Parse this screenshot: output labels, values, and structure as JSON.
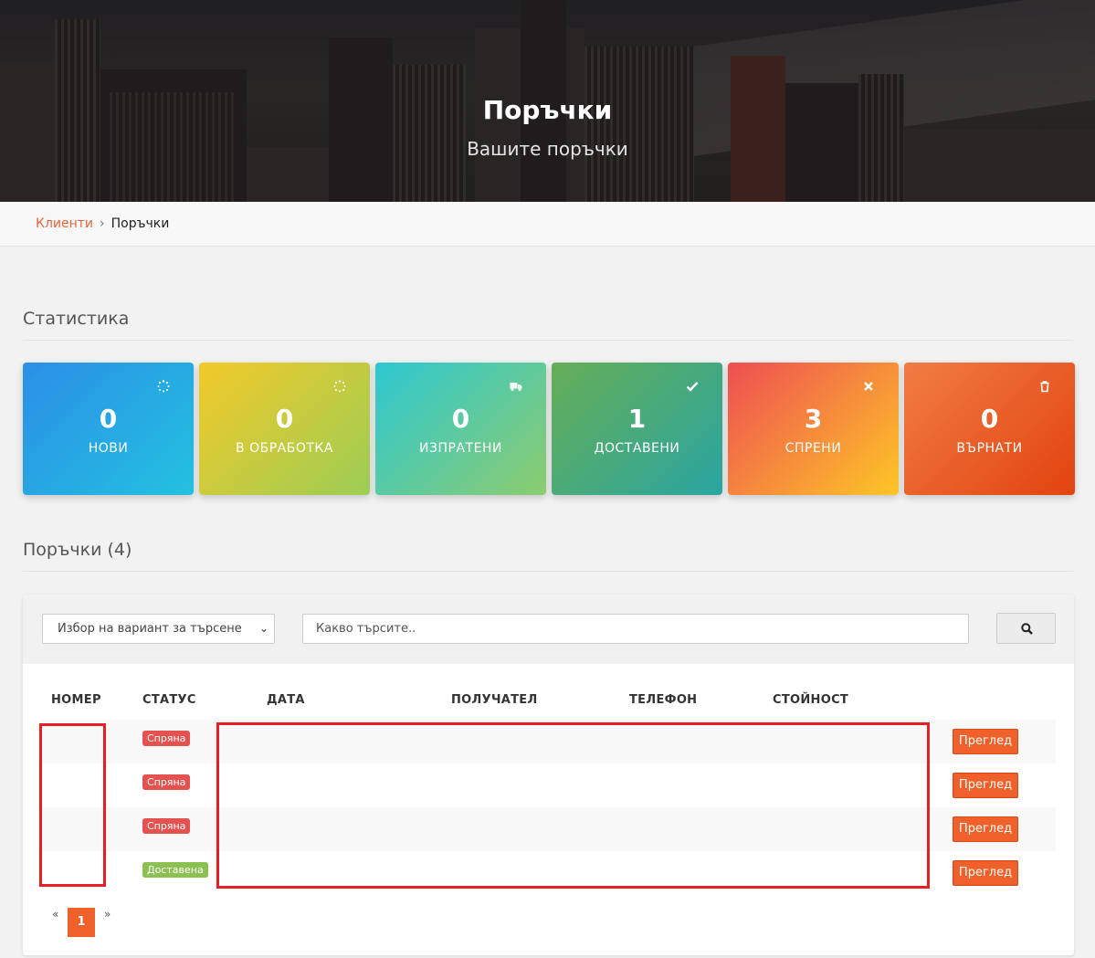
{
  "header": {
    "title": "Поръчки",
    "subtitle": "Вашите поръчки"
  },
  "breadcrumb": {
    "parent": "Клиенти",
    "current": "Поръчки"
  },
  "statistics": {
    "title": "Статистика",
    "cards": [
      {
        "value": "0",
        "label": "НОВИ",
        "icon": "spinner-icon"
      },
      {
        "value": "0",
        "label": "В ОБРАБОТКА",
        "icon": "spinner-icon"
      },
      {
        "value": "0",
        "label": "ИЗПРАТЕНИ",
        "icon": "truck-icon"
      },
      {
        "value": "1",
        "label": "ДОСТАВЕНИ",
        "icon": "check-icon"
      },
      {
        "value": "3",
        "label": "СПРЕНИ",
        "icon": "close-icon"
      },
      {
        "value": "0",
        "label": "ВЪРНАТИ",
        "icon": "trash-icon"
      }
    ]
  },
  "orders": {
    "title": "Поръчки (4)",
    "filter_placeholder": "Избор на вариант за търсене",
    "search_placeholder": "Какво търсите..",
    "columns": [
      "НОМЕР",
      "СТАТУС",
      "ДАТА",
      "ПОЛУЧАТЕЛ",
      "ТЕЛЕФОН",
      "СТОЙНОСТ"
    ],
    "rows": [
      {
        "status": "Спряна",
        "status_color": "#e4514e",
        "action": "Преглед"
      },
      {
        "status": "Спряна",
        "status_color": "#e4514e",
        "action": "Преглед"
      },
      {
        "status": "Спряна",
        "status_color": "#e4514e",
        "action": "Преглед"
      },
      {
        "status": "Доставена",
        "status_color": "#8cc152",
        "action": "Преглед"
      }
    ],
    "pagination": {
      "prev": "«",
      "current": "1",
      "next": "»"
    }
  },
  "colors": {
    "accent": "#f0602a",
    "link": "#e8643a"
  }
}
